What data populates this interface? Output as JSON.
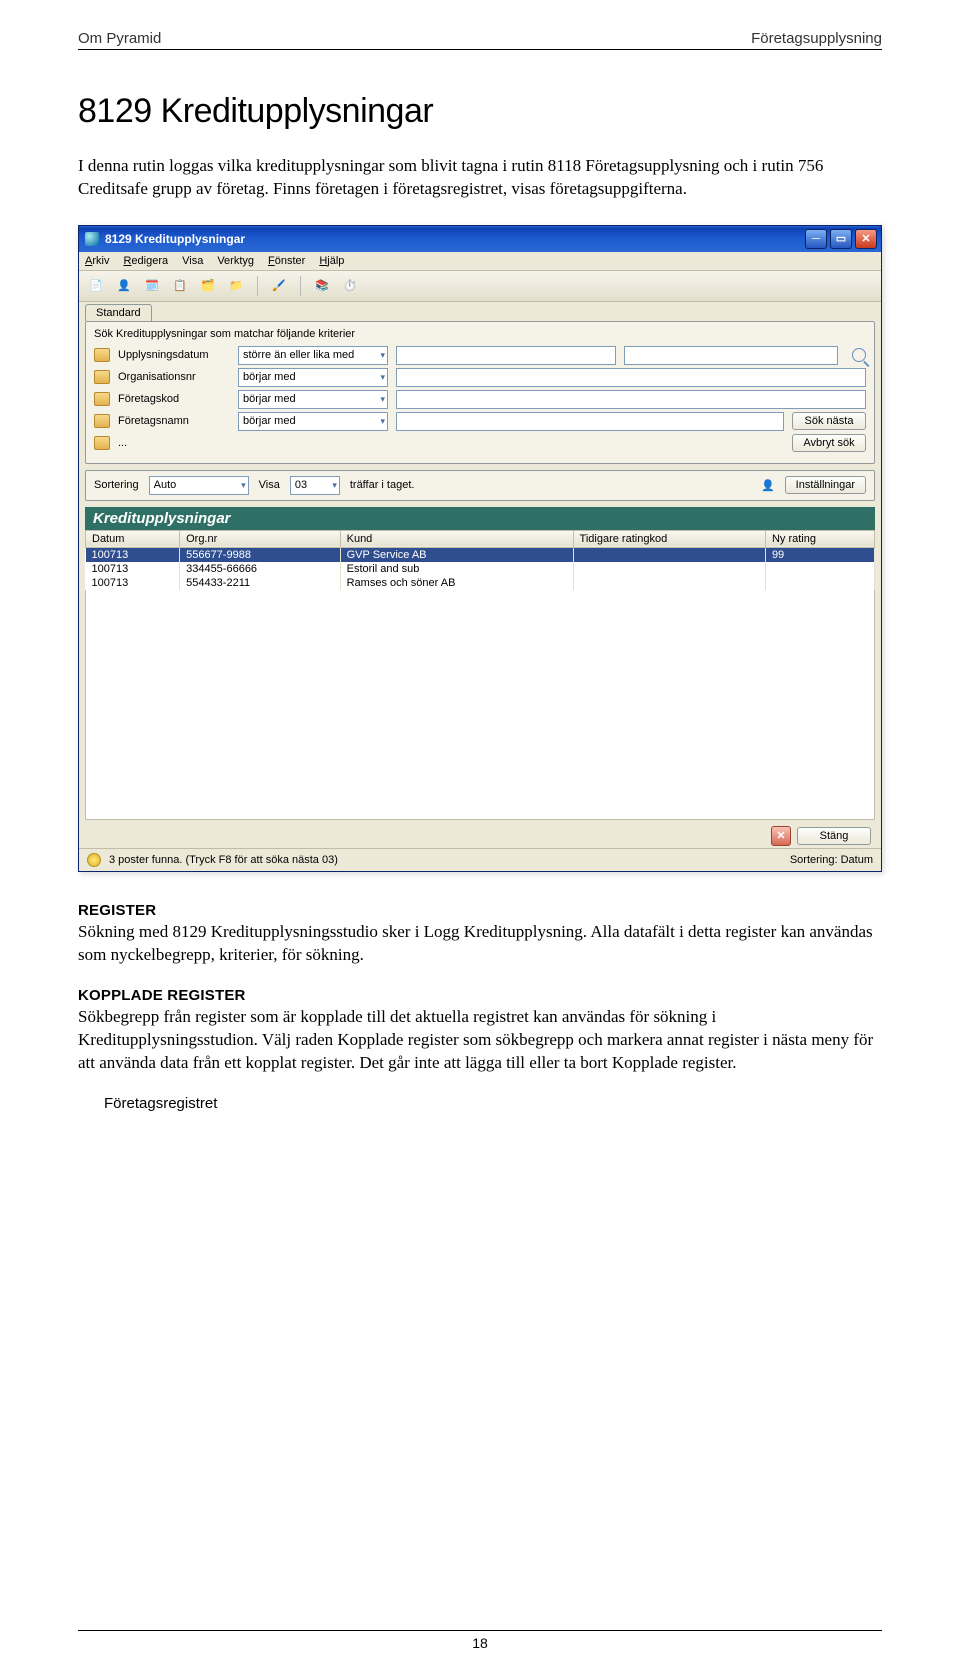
{
  "header": {
    "left": "Om Pyramid",
    "right": "Företagsupplysning"
  },
  "h1": "8129 Kreditupplysningar",
  "intro": "I denna rutin loggas vilka kreditupplysningar som blivit tagna i rutin 8118 Företagsupplysning och i rutin 756 Creditsafe grupp av företag. Finns företagen i företagsregistret, visas företagsuppgifterna.",
  "app": {
    "title": "8129 Kreditupplysningar",
    "menus": [
      "Arkiv",
      "Redigera",
      "Visa",
      "Verktyg",
      "Fönster",
      "Hjälp"
    ],
    "tab": "Standard",
    "search_title": "Sök  Kreditupplysningar som matchar följande kriterier",
    "criteria": [
      {
        "label": "Upplysningsdatum",
        "op": "större än eller lika med"
      },
      {
        "label": "Organisationsnr",
        "op": "börjar med"
      },
      {
        "label": "Företagskod",
        "op": "börjar med"
      },
      {
        "label": "Företagsnamn",
        "op": "börjar med"
      },
      {
        "label": "...",
        "op": ""
      }
    ],
    "btn_sok": "Sök nästa",
    "btn_avbryt": "Avbryt sök",
    "sort_lbl": "Sortering",
    "sort_val": "Auto",
    "visa_lbl": "Visa",
    "visa_val": "03",
    "visa_suffix": "träffar i taget.",
    "installningar": "Inställningar",
    "table_caption": "Kreditupplysningar",
    "cols": [
      "Datum",
      "Org.nr",
      "Kund",
      "Tidigare ratingkod",
      "Ny rating"
    ],
    "rows": [
      {
        "d": "100713",
        "o": "556677-9988",
        "k": "GVP Service AB",
        "t": "",
        "n": "99"
      },
      {
        "d": "100713",
        "o": "334455-66666",
        "k": "Estoril and sub",
        "t": "",
        "n": ""
      },
      {
        "d": "100713",
        "o": "554433-2211",
        "k": "Ramses och söner AB",
        "t": "",
        "n": ""
      }
    ],
    "close_btn": "Stäng",
    "status_left": "3 poster funna. (Tryck F8 för att söka nästa 03)",
    "status_right": "Sortering: Datum"
  },
  "register_h": "REGISTER",
  "register_p": "Sökning med 8129 Kreditupplysningsstudio sker i Logg Kreditupplysning. Alla datafält i detta register kan användas som nyckelbegrepp, kriterier, för sökning.",
  "kopplade_h": "KOPPLADE REGISTER",
  "kopplade_p": "Sökbegrepp från register som är kopplade till det aktuella registret kan användas för sökning i Kreditupplysningsstudion. Välj raden Kopplade register som sökbegrepp och markera annat register i nästa meny för att använda data från ett kopplat register. Det går inte att lägga till eller ta bort Kopplade register.",
  "indent_item": "Företagsregistret",
  "page_no": "18"
}
